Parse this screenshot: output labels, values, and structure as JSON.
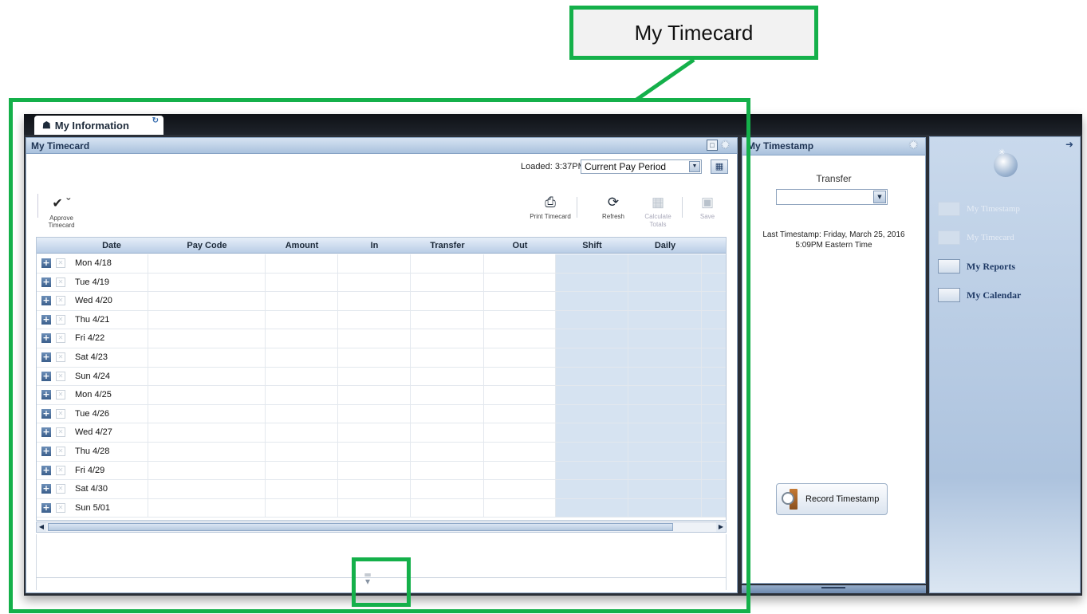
{
  "callout": {
    "label": "My Timecard"
  },
  "tabs": [
    {
      "label": "My Information"
    }
  ],
  "timecard": {
    "title": "My Timecard",
    "loaded": "Loaded: 3:37PM",
    "pay_period": "Current Pay Period",
    "toolbar": {
      "approve": "Approve Timecard",
      "print": "Print Timecard",
      "refresh": "Refresh",
      "calculate": "Calculate Totals",
      "save": "Save"
    },
    "columns": [
      "Date",
      "Pay Code",
      "Amount",
      "In",
      "Transfer",
      "Out",
      "Shift",
      "Daily"
    ],
    "rows": [
      "Mon 4/18",
      "Tue 4/19",
      "Wed 4/20",
      "Thu 4/21",
      "Fri 4/22",
      "Sat 4/23",
      "Sun 4/24",
      "Mon 4/25",
      "Tue 4/26",
      "Wed 4/27",
      "Thu 4/28",
      "Fri 4/29",
      "Sat 4/30",
      "Sun 5/01"
    ]
  },
  "timestamp": {
    "title": "My Timestamp",
    "transfer_label": "Transfer",
    "last_line1": "Last Timestamp: Friday, March 25, 2016",
    "last_line2": "5:09PM Eastern Time",
    "record_button": "Record Timestamp"
  },
  "nav": {
    "items": [
      {
        "label": "My Timestamp",
        "active": false
      },
      {
        "label": "My Timecard",
        "active": false
      },
      {
        "label": "My Reports",
        "active": true
      },
      {
        "label": "My Calendar",
        "active": true
      }
    ]
  },
  "colors": {
    "highlight": "#14b04a",
    "header_blue": "#a9c1dd",
    "shaded_columns": "#d6e3f1"
  }
}
